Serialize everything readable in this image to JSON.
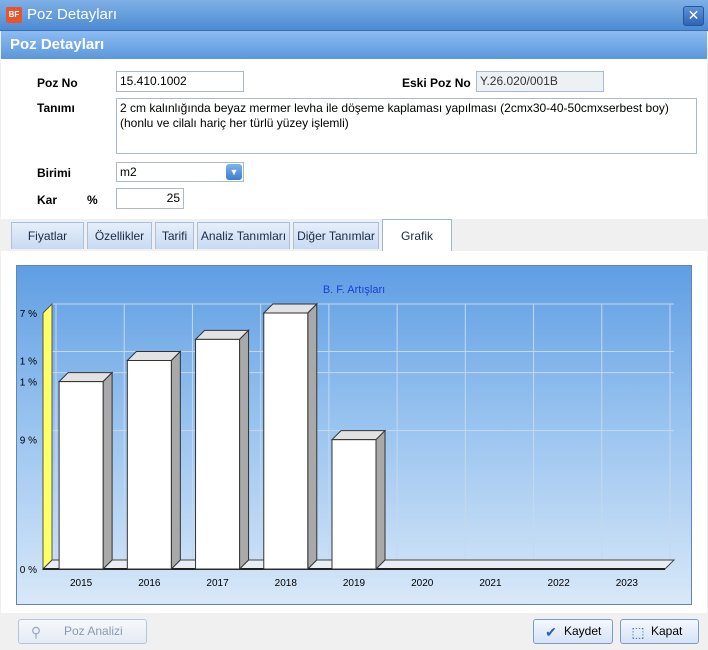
{
  "window": {
    "title": "Poz Detayları",
    "icon_text": "BF",
    "close_glyph": "✕"
  },
  "header": {
    "title": "Poz Detayları"
  },
  "form": {
    "poz_no_label": "Poz No",
    "poz_no_value": "15.410.1002",
    "eski_poz_no_label": "Eski Poz No",
    "eski_poz_no_value": "Y.26.020/001B",
    "tanimi_label": "Tanımı",
    "tanimi_value": "2 cm kalınlığında beyaz mermer levha ile döşeme kaplaması yapılması (2cmx30-40-50cmxserbest boy) (honlu ve cilalı hariç her türlü yüzey işlemli)",
    "birimi_label": "Birimi",
    "birimi_value": "m2",
    "kar_label": "Kar",
    "kar_unit": "%",
    "kar_value": "25"
  },
  "tabs": [
    {
      "label": "Fiyatlar",
      "active": false
    },
    {
      "label": "Özellikler",
      "active": false
    },
    {
      "label": "Tarifi",
      "active": false
    },
    {
      "label": "Analiz Tanımları",
      "active": false
    },
    {
      "label": "Diğer Tanımlar",
      "active": false
    },
    {
      "label": "Grafik",
      "active": true
    }
  ],
  "chart_data": {
    "type": "bar",
    "title": "B. F. Artışları",
    "categories": [
      "2015",
      "2016",
      "2017",
      "2018",
      "2019",
      "2020",
      "2021",
      "2022",
      "2023"
    ],
    "values": [
      71,
      79,
      87,
      97,
      49,
      null,
      null,
      null,
      null
    ],
    "y_tick_values": [
      0,
      49,
      71,
      79,
      97
    ],
    "y_tick_labels": [
      "0 %",
      "9 %",
      "1 %",
      "1 %",
      "7 %"
    ],
    "ylim": [
      0,
      97
    ],
    "grid": true,
    "colors": {
      "bar_front": "#ffffff",
      "bar_side": "#a9a9a9",
      "bar_top": "#e2e2e2",
      "wall": "#ffff66",
      "grid": "#c5d8ee",
      "title": "#1a3fd0"
    }
  },
  "footer": {
    "poz_analizi_label": "Poz Analizi",
    "kaydet_label": "Kaydet",
    "kapat_label": "Kapat"
  }
}
